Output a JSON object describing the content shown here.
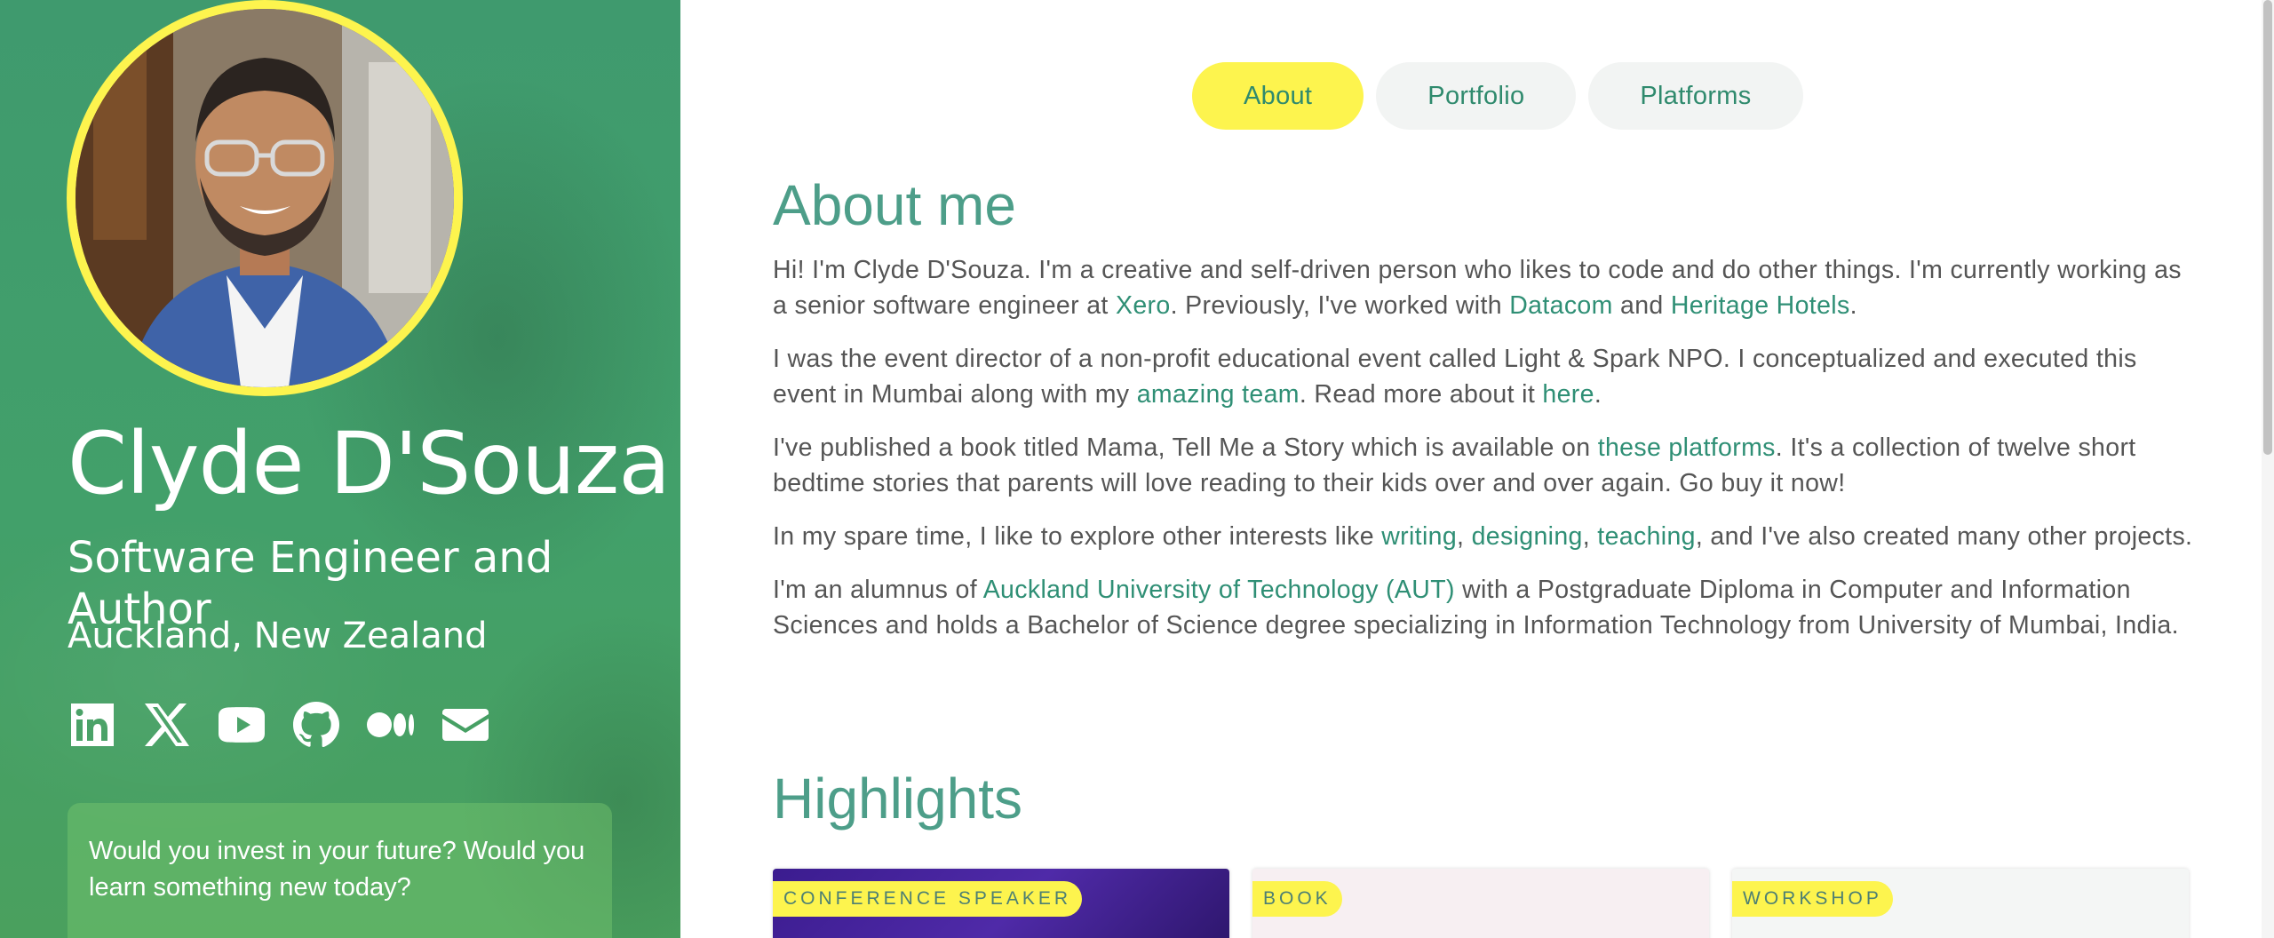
{
  "sidebar": {
    "name": "Clyde D'Souza",
    "title": "Software Engineer and Author",
    "location": "Auckland, New Zealand",
    "social": [
      {
        "icon": "linkedin-icon"
      },
      {
        "icon": "x-icon"
      },
      {
        "icon": "youtube-icon"
      },
      {
        "icon": "github-icon"
      },
      {
        "icon": "medium-icon"
      },
      {
        "icon": "email-icon"
      }
    ],
    "quote": "Would you invest in your future? Would you learn something new today?"
  },
  "nav": {
    "tabs": [
      "About",
      "Portfolio",
      "Platforms"
    ],
    "active": "About"
  },
  "about": {
    "heading": "About me",
    "p1": {
      "t1": "Hi! I'm Clyde D'Souza. I'm a creative and self-driven person who likes to code and do other things. I'm currently working as a senior software engineer at ",
      "l1": "Xero",
      "t2": ". Previously, I've worked with ",
      "l2": "Datacom",
      "t3": " and ",
      "l3": "Heritage Hotels",
      "t4": "."
    },
    "p2": {
      "t1": "I was the event director of a non-profit educational event called Light & Spark NPO. I conceptualized and executed this event in Mumbai along with my ",
      "l1": "amazing team",
      "t2": ". Read more about it ",
      "l2": "here",
      "t3": "."
    },
    "p3": {
      "t1": "I've published a book titled Mama, Tell Me a Story which is available on ",
      "l1": "these platforms",
      "t2": ". It's a collection of twelve short bedtime stories that parents will love reading to their kids over and over again. Go buy it now!"
    },
    "p4": {
      "t1": "In my spare time, I like to explore other interests like ",
      "l1": "writing",
      "t2": ", ",
      "l2": "designing",
      "t3": ", ",
      "l3": "teaching",
      "t4": ", and I've also created many other projects."
    },
    "p5": {
      "t1": "I'm an alumnus of ",
      "l1": "Auckland University of Technology (AUT)",
      "t2": " with a Postgraduate Diploma in Computer and Information Sciences and holds a Bachelor of Science degree specializing in Information Technology from University of Mumbai, India."
    }
  },
  "highlights": {
    "heading": "Highlights",
    "cards": [
      {
        "badge": "CONFERENCE SPEAKER"
      },
      {
        "badge": "BOOK"
      },
      {
        "badge": "WORKSHOP"
      }
    ]
  },
  "colors": {
    "accent_yellow": "#fdf44e",
    "brand_green": "#3f9a6e",
    "link_green": "#2f8f75",
    "heading_teal": "#4d9e89"
  }
}
